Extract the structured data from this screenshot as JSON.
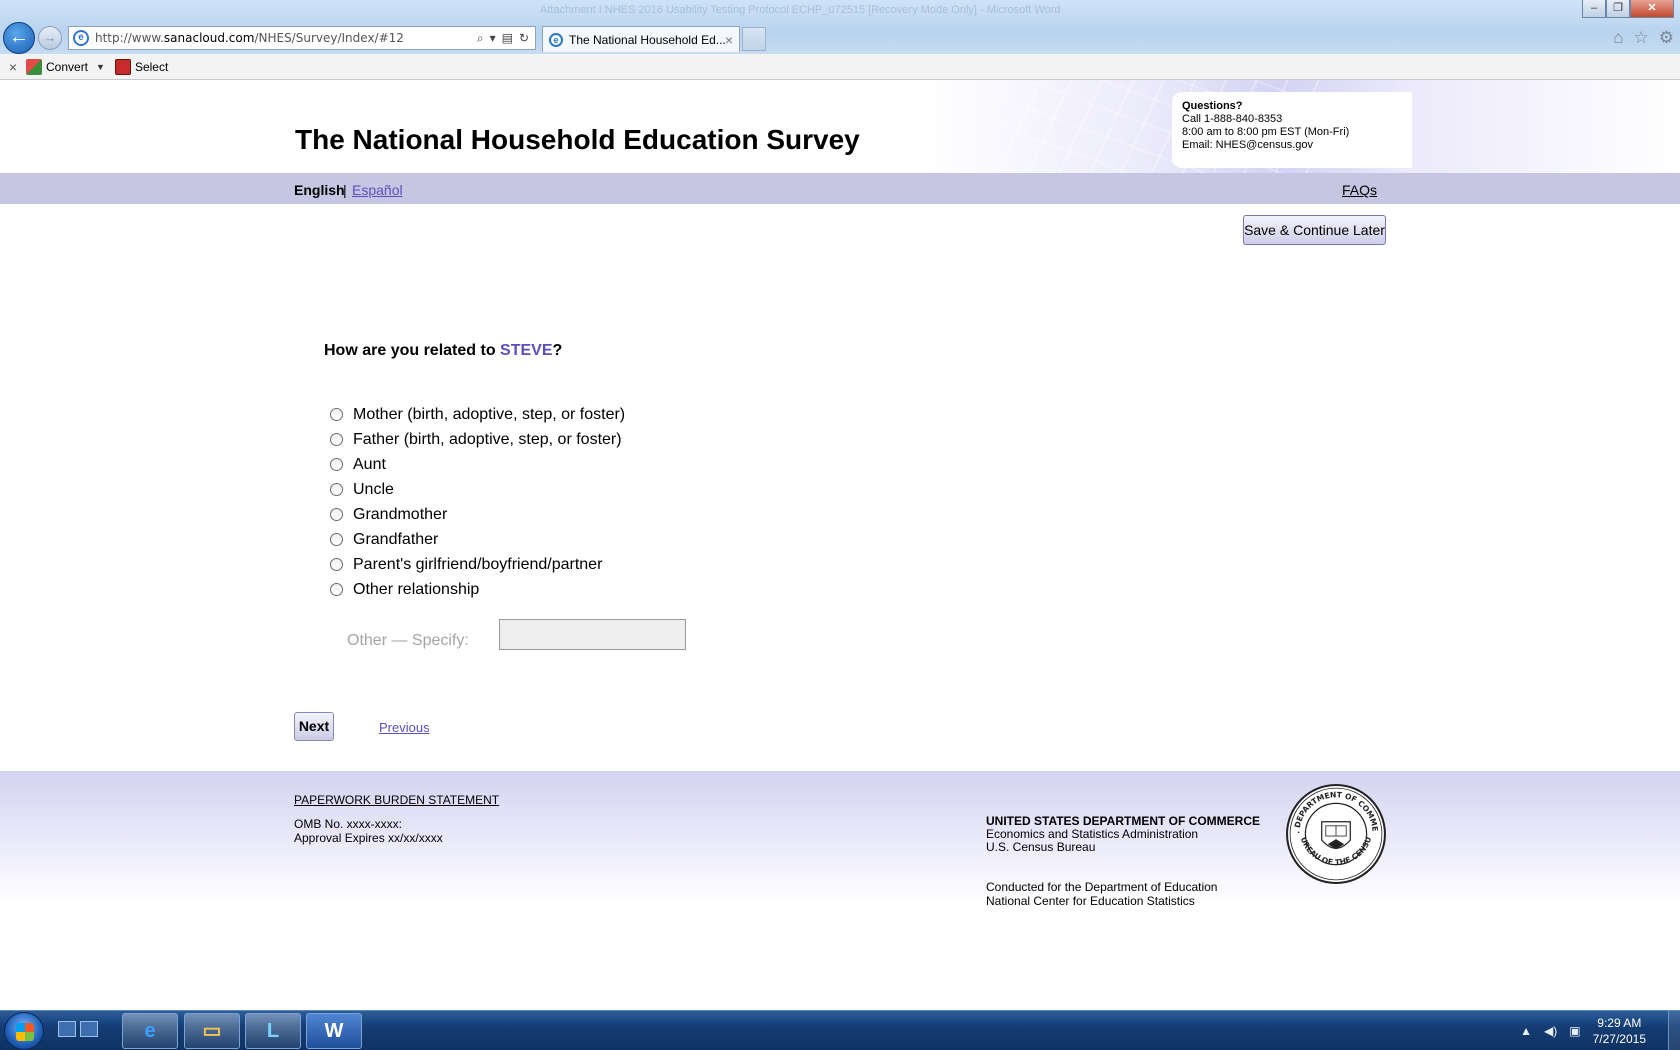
{
  "browser": {
    "window_title": "Attachment I NHES 2016 Usability Testing Protocol ECHP_072515 [Recovery Mode Only] - Microsoft Word",
    "back_icon": "back-arrow-icon",
    "forward_icon": "forward-arrow-icon",
    "url_prefix": "http://www.",
    "url_domain": "sanacloud.com",
    "url_path": "/NHES/Survey/Index/#12",
    "tab_title": "The National Household Ed...",
    "tab_close": "×",
    "window_buttons": {
      "minimize": "–",
      "restore": "❐",
      "close": "✕"
    },
    "right_icons": [
      "home-icon",
      "favorites-star-icon",
      "gear-icon"
    ]
  },
  "command_bar": {
    "close": "×",
    "convert_label": "Convert",
    "select_label": "Select"
  },
  "header": {
    "title": "The National Household Education Survey",
    "questions_label": "Questions?",
    "phone": "Call 1-888-840-8353",
    "hours": "8:00 am to 8:00 pm EST (Mon-Fri)",
    "email_label": "Email: ",
    "email": "NHES@census.gov"
  },
  "lang_bar": {
    "english": "English",
    "separator": "|",
    "espanol": "Español",
    "faqs": "FAQs"
  },
  "save_button": "Save & Continue Later",
  "question": {
    "prefix": "How are you related to ",
    "name": "STEVE",
    "suffix": "?"
  },
  "options": [
    "Mother (birth, adoptive, step, or foster)",
    "Father (birth, adoptive, step, or foster)",
    "Aunt",
    "Uncle",
    "Grandmother",
    "Grandfather",
    "Parent's girlfriend/boyfriend/partner",
    "Other relationship"
  ],
  "other_specify": {
    "label": "Other — Specify:",
    "value": ""
  },
  "nav": {
    "next": "Next",
    "previous": "Previous"
  },
  "footer": {
    "burden_link": "PAPERWORK BURDEN STATEMENT",
    "omb": "OMB No. xxxx-xxxx:",
    "approval": "Approval Expires xx/xx/xxxx",
    "dept": "UNITED STATES DEPARTMENT OF COMMERCE",
    "esa": "Economics and Statistics Administration",
    "census": "U.S. Census Bureau",
    "conducted": "Conducted for the Department of Education",
    "nces": "National Center for Education Statistics",
    "seal_top_text": "U.S. DEPARTMENT OF COMMERCE",
    "seal_bottom_text": "BUREAU OF THE CENSUS"
  },
  "taskbar": {
    "time": "9:29 AM",
    "date": "7/27/2015",
    "apps": [
      "internet-explorer-icon",
      "file-explorer-icon",
      "lync-icon",
      "word-icon"
    ]
  },
  "colors": {
    "accent_purple": "#5b4fbf",
    "lang_bar": "#c6c6e2",
    "taskbar": "#153d74"
  }
}
